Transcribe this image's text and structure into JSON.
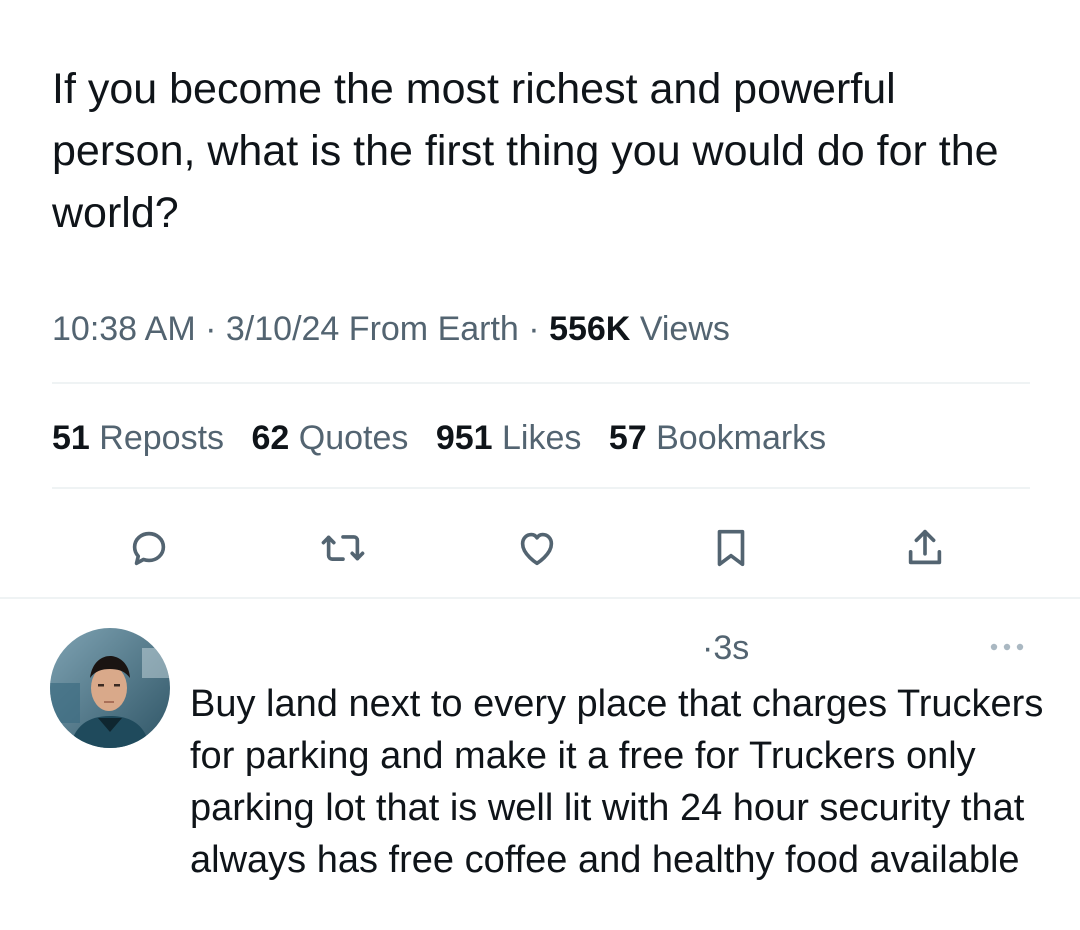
{
  "post": {
    "text": "If you become the most richest and powerful person, what is the first thing you would do for the world?",
    "time": "10:38 AM",
    "date": "3/10/24",
    "location": "From Earth",
    "views_count": "556K",
    "views_label": "Views",
    "separator": "·"
  },
  "stats": [
    {
      "count": "51",
      "label": "Reposts"
    },
    {
      "count": "62",
      "label": "Quotes"
    },
    {
      "count": "951",
      "label": "Likes"
    },
    {
      "count": "57",
      "label": "Bookmarks"
    }
  ],
  "actions": {
    "reply_icon": "speech-bubble-icon",
    "repost_icon": "repost-arrows-icon",
    "like_icon": "heart-icon",
    "bookmark_icon": "bookmark-icon",
    "share_icon": "upload-share-icon"
  },
  "reply": {
    "time": "·3s",
    "text": "Buy land next to every place that charges Truckers for parking and make it a free for Truckers only parking lot that is well lit with 24 hour security that always has free coffee and healthy food available",
    "more_icon": "more-dots-icon"
  },
  "colors": {
    "text_primary": "#0f1419",
    "text_secondary": "#536471",
    "divider": "#eff3f4"
  }
}
